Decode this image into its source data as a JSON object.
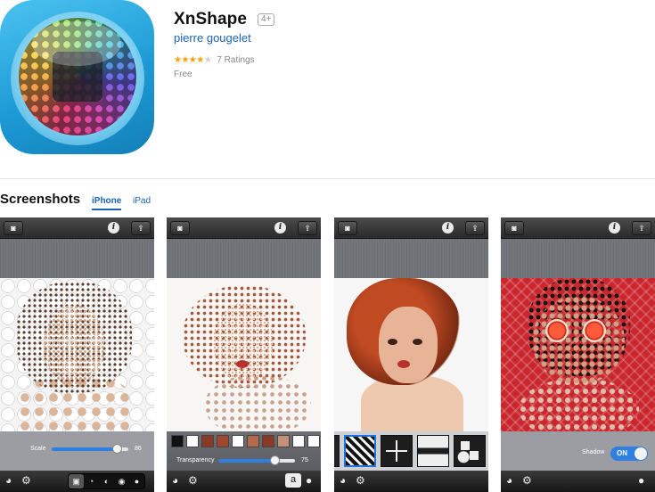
{
  "app": {
    "title": "XnShape",
    "age_rating": "4+",
    "developer": "pierre gougelet",
    "rating": 4.1,
    "ratings_count_text": "7 Ratings",
    "price": "Free"
  },
  "screenshots": {
    "heading": "Screenshots",
    "tabs": [
      {
        "label": "iPhone",
        "active": true
      },
      {
        "label": "iPad",
        "active": false
      }
    ],
    "items": [
      {
        "slider_label": "Scale",
        "slider_value": "86",
        "slider_fraction": 0.86
      },
      {
        "slider_label": "Transparency",
        "slider_value": "75",
        "slider_fraction": 0.75,
        "swatches": [
          "#111111",
          "#ffffff",
          "#8a3a24",
          "#a0482e",
          "#ffffff",
          "#b56a4c",
          "#8a3a24",
          "#c49078",
          "#ffffff",
          "#ffffff"
        ]
      },
      {
        "patterns": [
          "stripes",
          "plus",
          "hourglass",
          "shapes-mix"
        ],
        "selected_pattern": "stripes"
      },
      {
        "toggle_label": "Shadow",
        "toggle_value": "ON"
      }
    ]
  },
  "toolbar": {
    "info_glyph": "i",
    "share_glyph": "⇪",
    "camera_glyph": "◙",
    "font_glyph": "a"
  },
  "colors": {
    "link": "#1a63b8",
    "star": "#ff9f0a",
    "slider_fill": "#2f7fe0"
  }
}
